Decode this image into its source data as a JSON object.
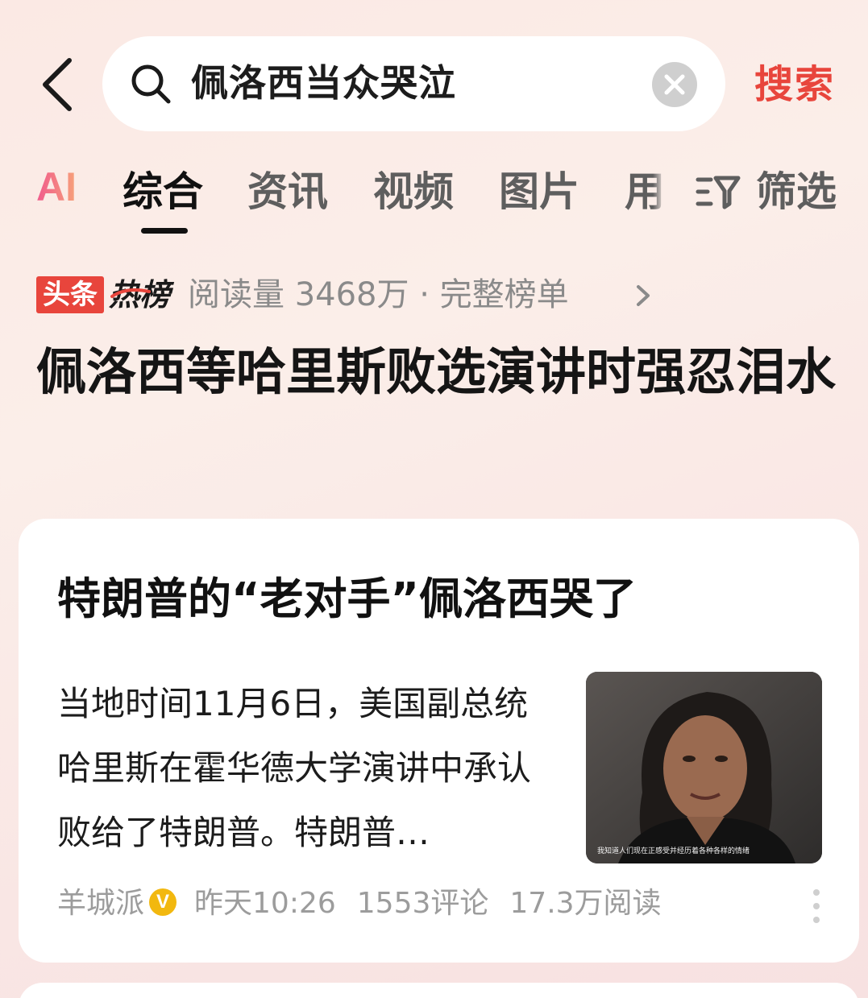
{
  "search": {
    "query": "佩洛西当众哭泣",
    "submit_label": "搜索"
  },
  "tabs": {
    "ai_label": "AI",
    "items": [
      {
        "label": "综合",
        "active": true
      },
      {
        "label": "资讯",
        "active": false
      },
      {
        "label": "视频",
        "active": false
      },
      {
        "label": "图片",
        "active": false
      },
      {
        "label": "用",
        "active": false
      }
    ],
    "filter_label": "筛选"
  },
  "hotlist": {
    "badge": "头条",
    "badge_word": "热榜",
    "meta": "阅读量 3468万 · 完整榜单",
    "headline": "佩洛西等哈里斯败选演讲时强忍泪水"
  },
  "article": {
    "title": "特朗普的“老对手”佩洛西哭了",
    "summary": "当地时间11月6日，美国副总统哈里斯在霍华德大学演讲中承认败给了特朗普。特朗普…",
    "thumbnail_caption": "我知道人们现在正感受并经历着各种各样的情绪",
    "source": "羊城派",
    "verified_mark": "V",
    "time": "昨天10:26",
    "comments": "1553评论",
    "reads": "17.3万阅读"
  },
  "colors": {
    "accent": "#e8453c",
    "verified": "#f2b80f"
  },
  "icons": [
    "back-arrow-icon",
    "search-icon",
    "clear-icon",
    "filter-icon",
    "chevron-right-icon",
    "more-icon"
  ]
}
